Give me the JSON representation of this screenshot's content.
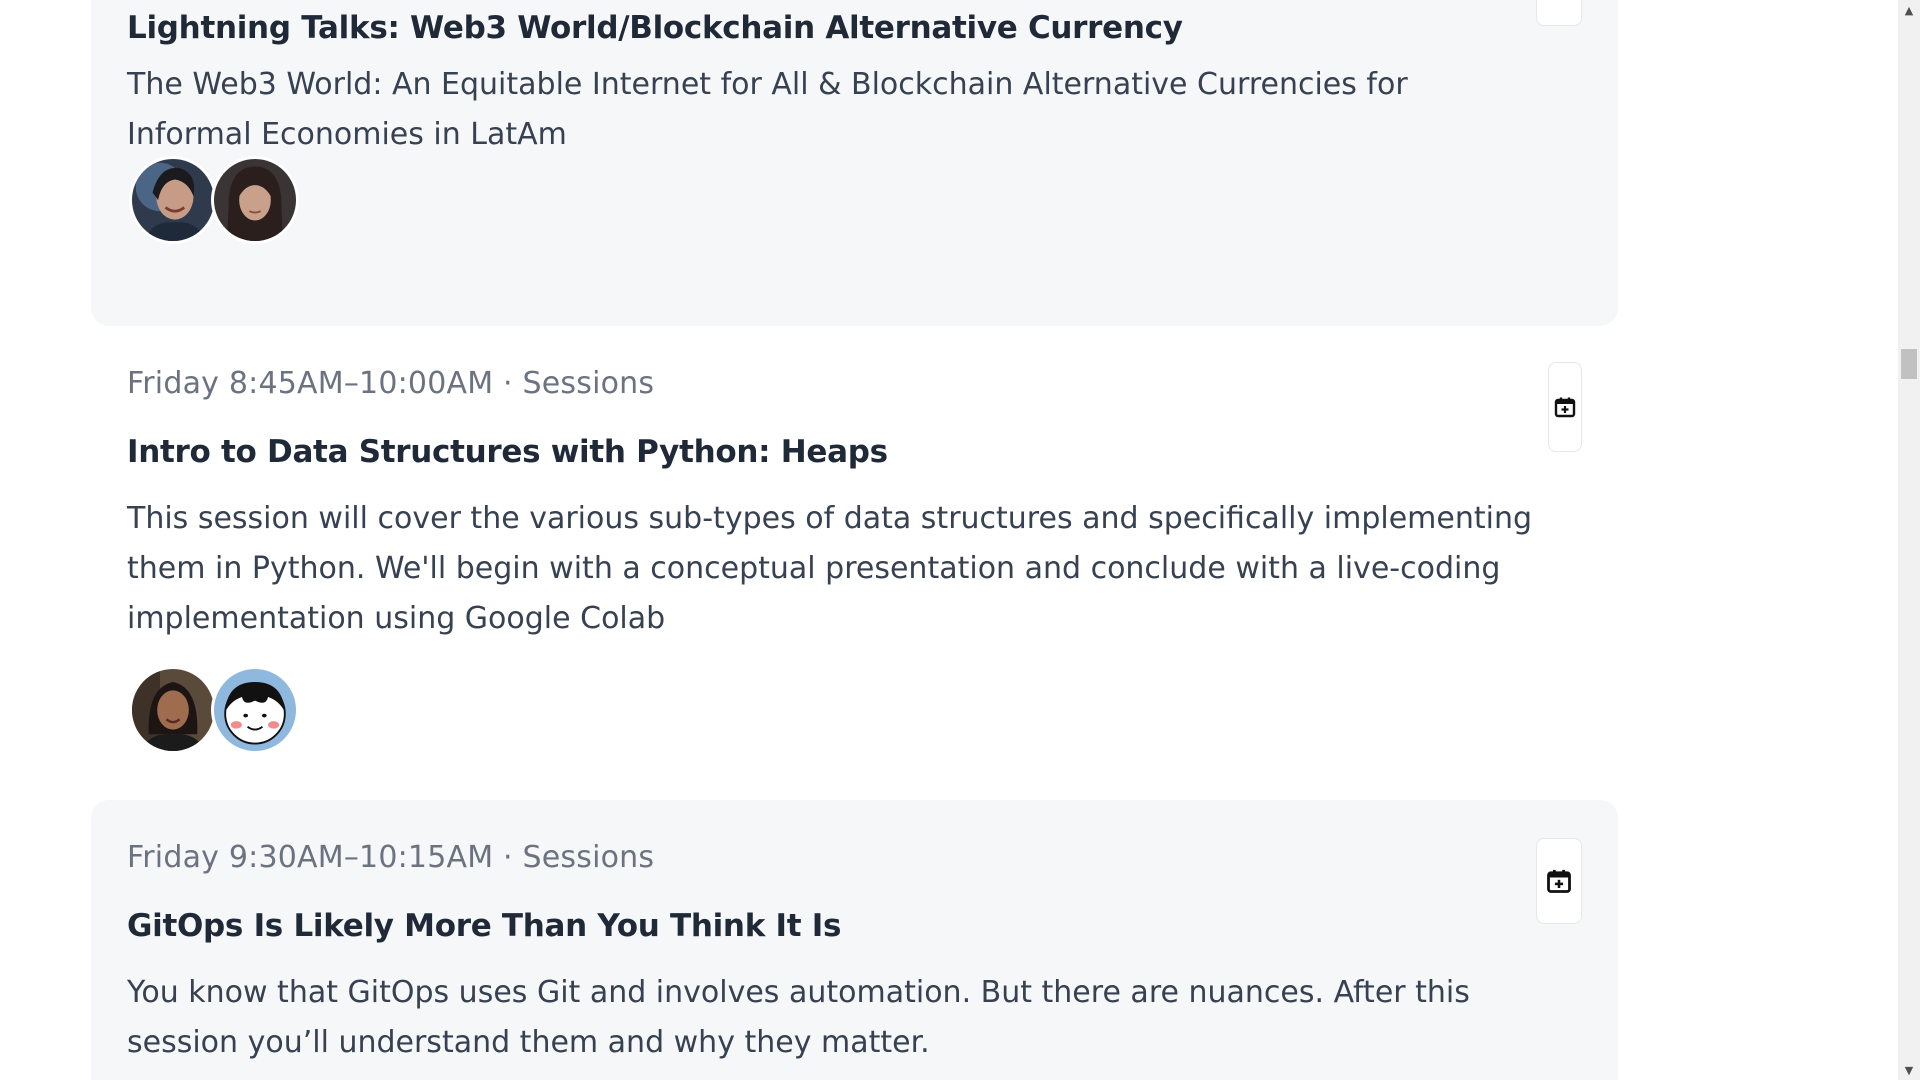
{
  "sessions": [
    {
      "title": "Lightning Talks: Web3 World/Blockchain Alternative Currency",
      "description": "The Web3 World: An Equitable Internet for All & Blockchain Alternative Currencies for Informal Economies in LatAm",
      "speakers": [
        {
          "avatar": "speaker-photo"
        },
        {
          "avatar": "speaker-photo"
        }
      ]
    },
    {
      "meta": "Friday 8:45AM–10:00AM · Sessions",
      "title": "Intro to Data Structures with Python: Heaps",
      "description": "This session will cover the various sub-types of data structures and specifically implementing them in Python. We'll begin with a conceptual presentation and conclude with a live-coding implementation using Google Colab",
      "speakers": [
        {
          "avatar": "speaker-photo"
        },
        {
          "avatar": "cartoon-face"
        }
      ]
    },
    {
      "meta": "Friday 9:30AM–10:15AM · Sessions",
      "title": "GitOps Is Likely More Than You Think It Is",
      "description": "You know that GitOps uses Git and involves automation. But there are nuances. After this session you’ll understand them and why they matter."
    }
  ],
  "icons": {
    "add_to_calendar": "calendar-plus-icon",
    "scroll_up": "▲",
    "scroll_down": "▼"
  },
  "colors": {
    "shaded_card": "#f6f7f9",
    "meta_text": "#6b7280",
    "title_text": "#1f2937"
  }
}
